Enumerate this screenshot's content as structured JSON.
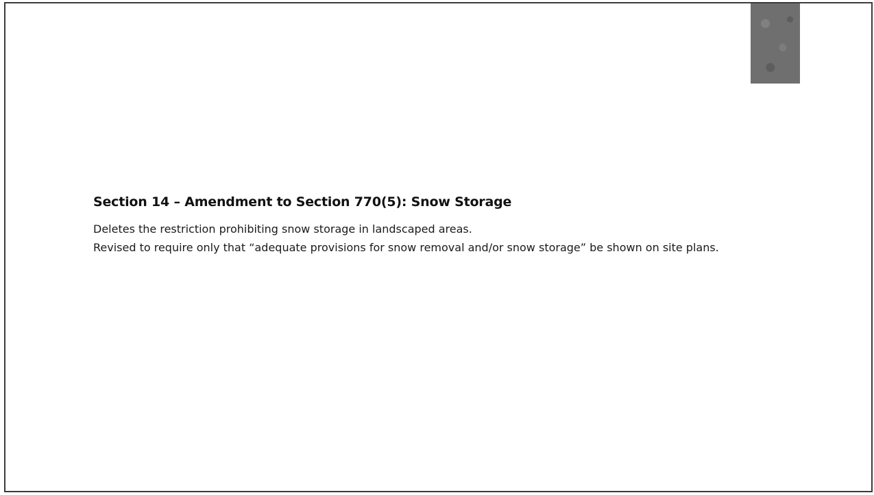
{
  "slide": {
    "title": "Section 14 – Amendment to Section 770(5): Snow Storage",
    "paragraphs": [
      "Deletes the restriction prohibiting snow storage in landscaped areas.",
      "Revised to require only that “adequate provisions for snow removal and/or snow storage” be shown on site plans."
    ]
  }
}
